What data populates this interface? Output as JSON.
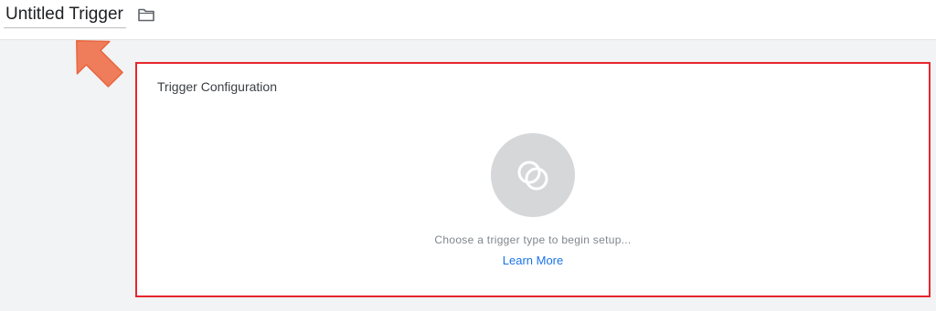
{
  "header": {
    "title": "Untitled Trigger",
    "folder_icon": "folder-outline-icon"
  },
  "annotation": {
    "arrow_color": "#ef7d5b",
    "highlight_border_color": "#e8262d"
  },
  "trigger_config": {
    "heading": "Trigger Configuration",
    "placeholder_icon": "overlapping-circles-icon",
    "hint": "Choose a trigger type to begin setup...",
    "learn_more_label": "Learn More"
  },
  "colors": {
    "link": "#1a73e8",
    "page_background": "#f1f3f4",
    "icon_circle": "#d5d7d9"
  }
}
